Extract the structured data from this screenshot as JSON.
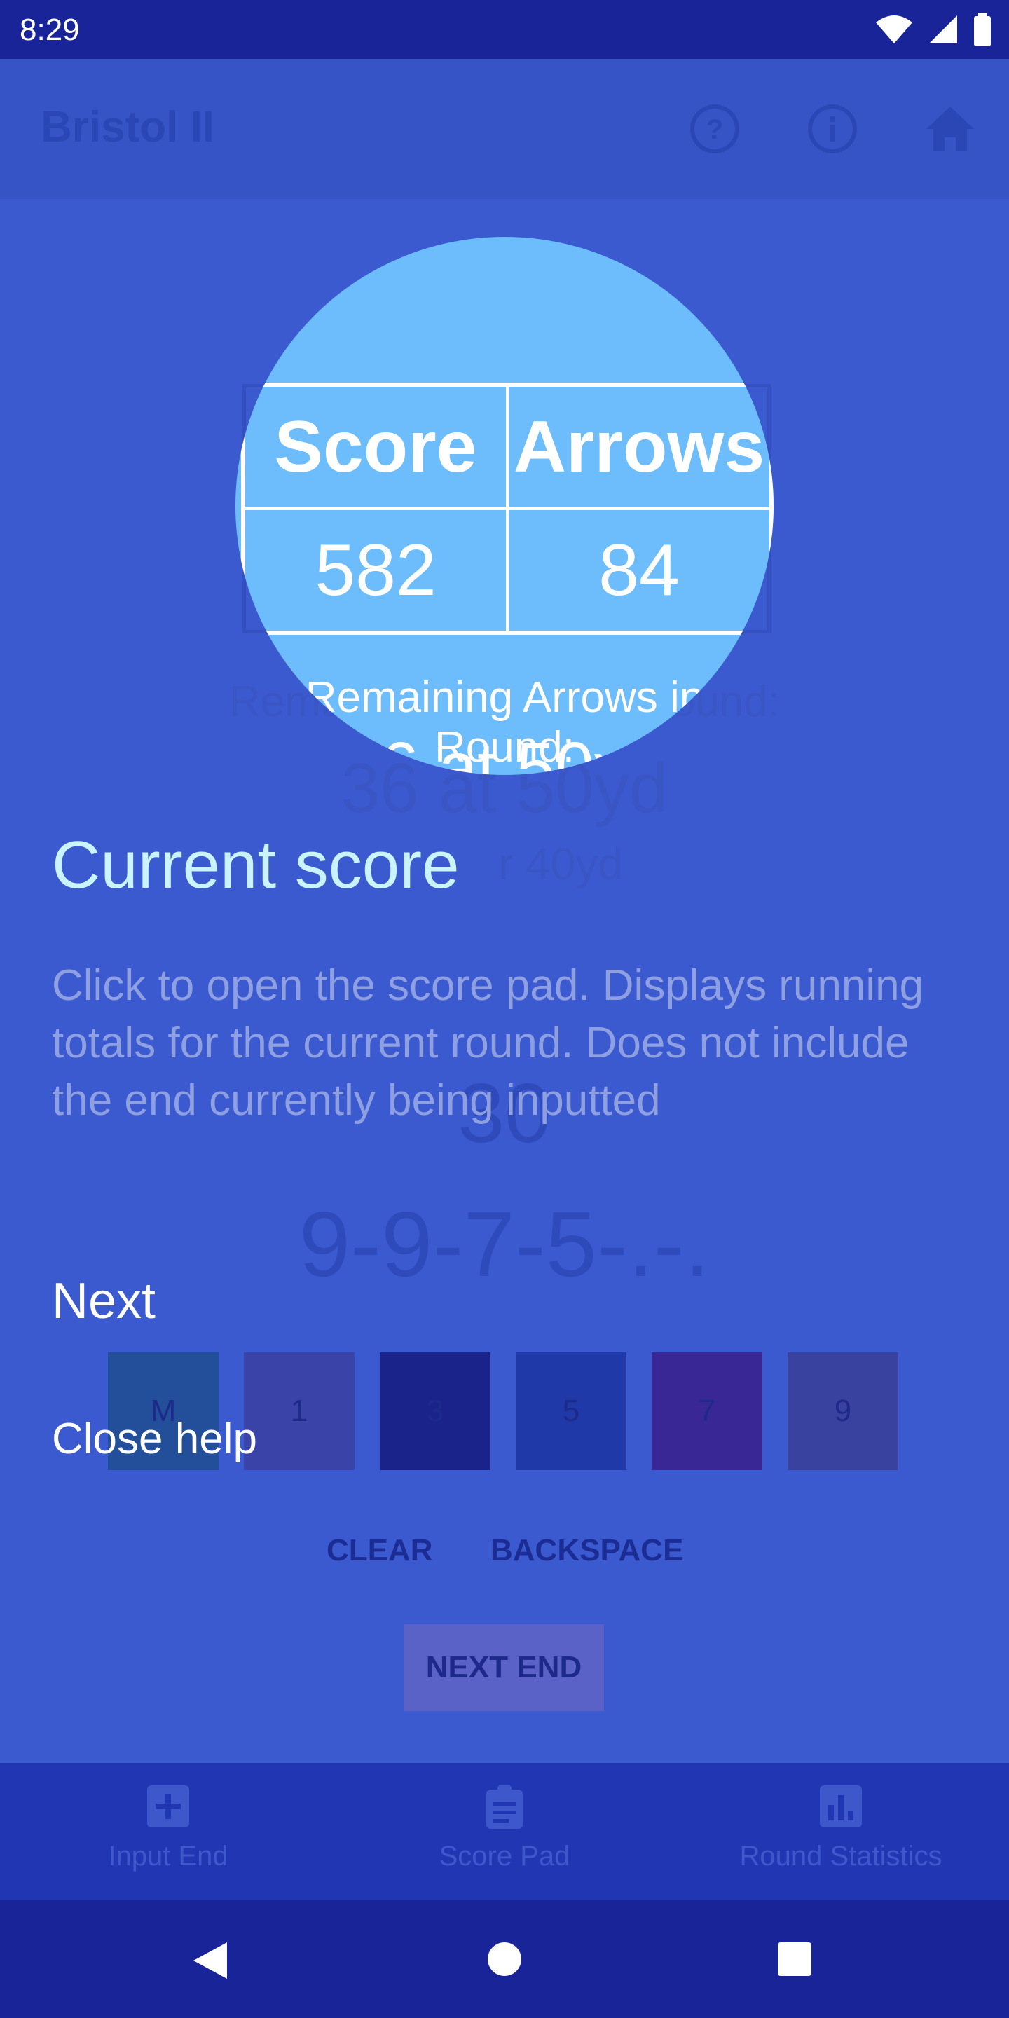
{
  "status_bar": {
    "time": "8:29"
  },
  "app_bar": {
    "title": "Bristol II",
    "icons": [
      "help-icon",
      "info-icon",
      "home-icon"
    ]
  },
  "score_table": {
    "headers": [
      "Score",
      "Arrows"
    ],
    "values": [
      "582",
      "84"
    ]
  },
  "remaining": {
    "label": "Remaining Arrows in Round:",
    "line1": "36 at 50yd",
    "line2_partial": "r 40yd"
  },
  "current_end": {
    "total": "30",
    "arrows": "9-9-7-5-.-."
  },
  "keypad": {
    "keys": [
      {
        "label": "M",
        "color": "#234e9a"
      },
      {
        "label": "1",
        "color": "#3a43a8"
      },
      {
        "label": "3",
        "color": "#19238a"
      },
      {
        "label": "5",
        "color": "#1f3aa8"
      },
      {
        "label": "7",
        "color": "#3a2796"
      },
      {
        "label": "9",
        "color": "#39439f"
      }
    ]
  },
  "actions": {
    "clear": "CLEAR",
    "backspace": "BACKSPACE",
    "next_end": "NEXT END"
  },
  "bottom_nav": {
    "items": [
      {
        "label": "Input End",
        "icon": "add-box-icon"
      },
      {
        "label": "Score Pad",
        "icon": "clipboard-icon"
      },
      {
        "label": "Round Statistics",
        "icon": "bar-chart-icon"
      }
    ]
  },
  "help": {
    "title": "Current score",
    "description": "Click to open the score pad. Displays running totals for the current round. Does not include the end currently being inputted",
    "next": "Next",
    "close": "Close help"
  },
  "spotlight": {
    "remaining_partial": "Remaining Arrows in Round:",
    "line1_partial": "36 at 50yd"
  },
  "colors": {
    "overlay_bg": "#3c5ad0",
    "spotlight": "#6dbdfc",
    "help_title": "#c8f3ff",
    "bottom_nav_bg": "#2136b3",
    "system_bar": "#1a2499"
  }
}
